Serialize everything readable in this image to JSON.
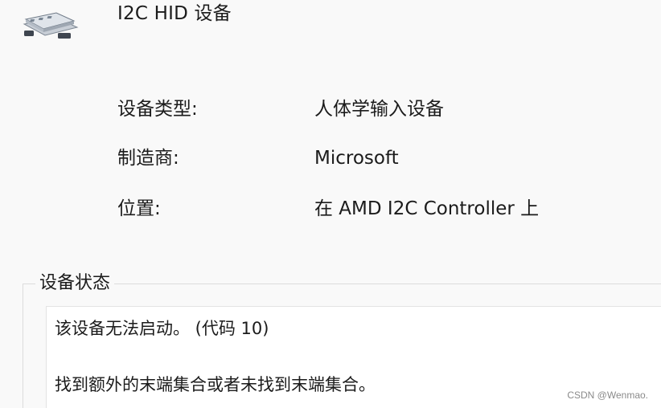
{
  "device": {
    "icon": "hid-device-icon",
    "name": "I2C HID 设备"
  },
  "properties": [
    {
      "label": "设备类型:",
      "value": "人体学输入设备"
    },
    {
      "label": "制造商:",
      "value": "Microsoft"
    },
    {
      "label": "位置:",
      "value": "在 AMD I2C Controller 上"
    }
  ],
  "device_status": {
    "title": "设备状态",
    "lines": [
      "该设备无法启动。 (代码 10)",
      "找到额外的末端集合或者未找到末端集合。"
    ]
  },
  "watermark": "CSDN @Wenmao."
}
